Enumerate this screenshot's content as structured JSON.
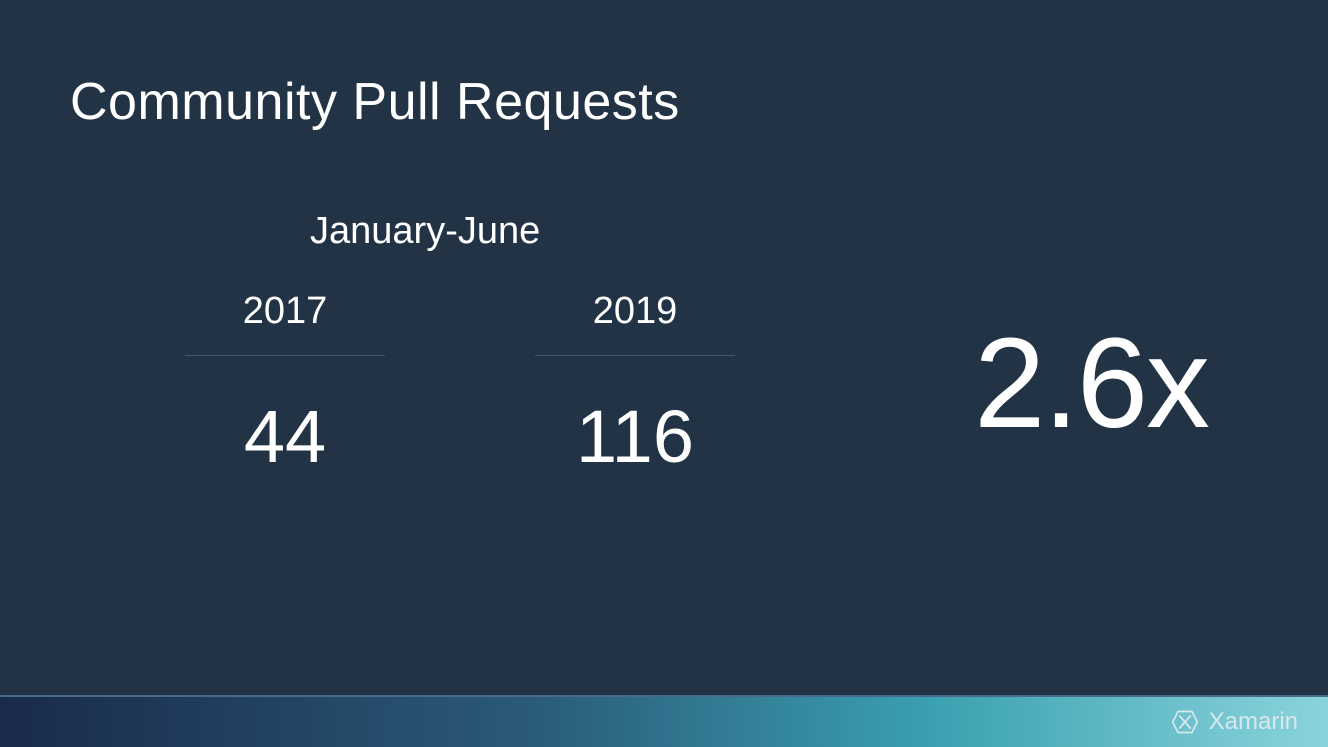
{
  "title": "Community Pull Requests",
  "subtitle": "January-June",
  "stats": [
    {
      "year": "2017",
      "value": "44"
    },
    {
      "year": "2019",
      "value": "116"
    }
  ],
  "multiplier": "2.6x",
  "brand": "Xamarin"
}
